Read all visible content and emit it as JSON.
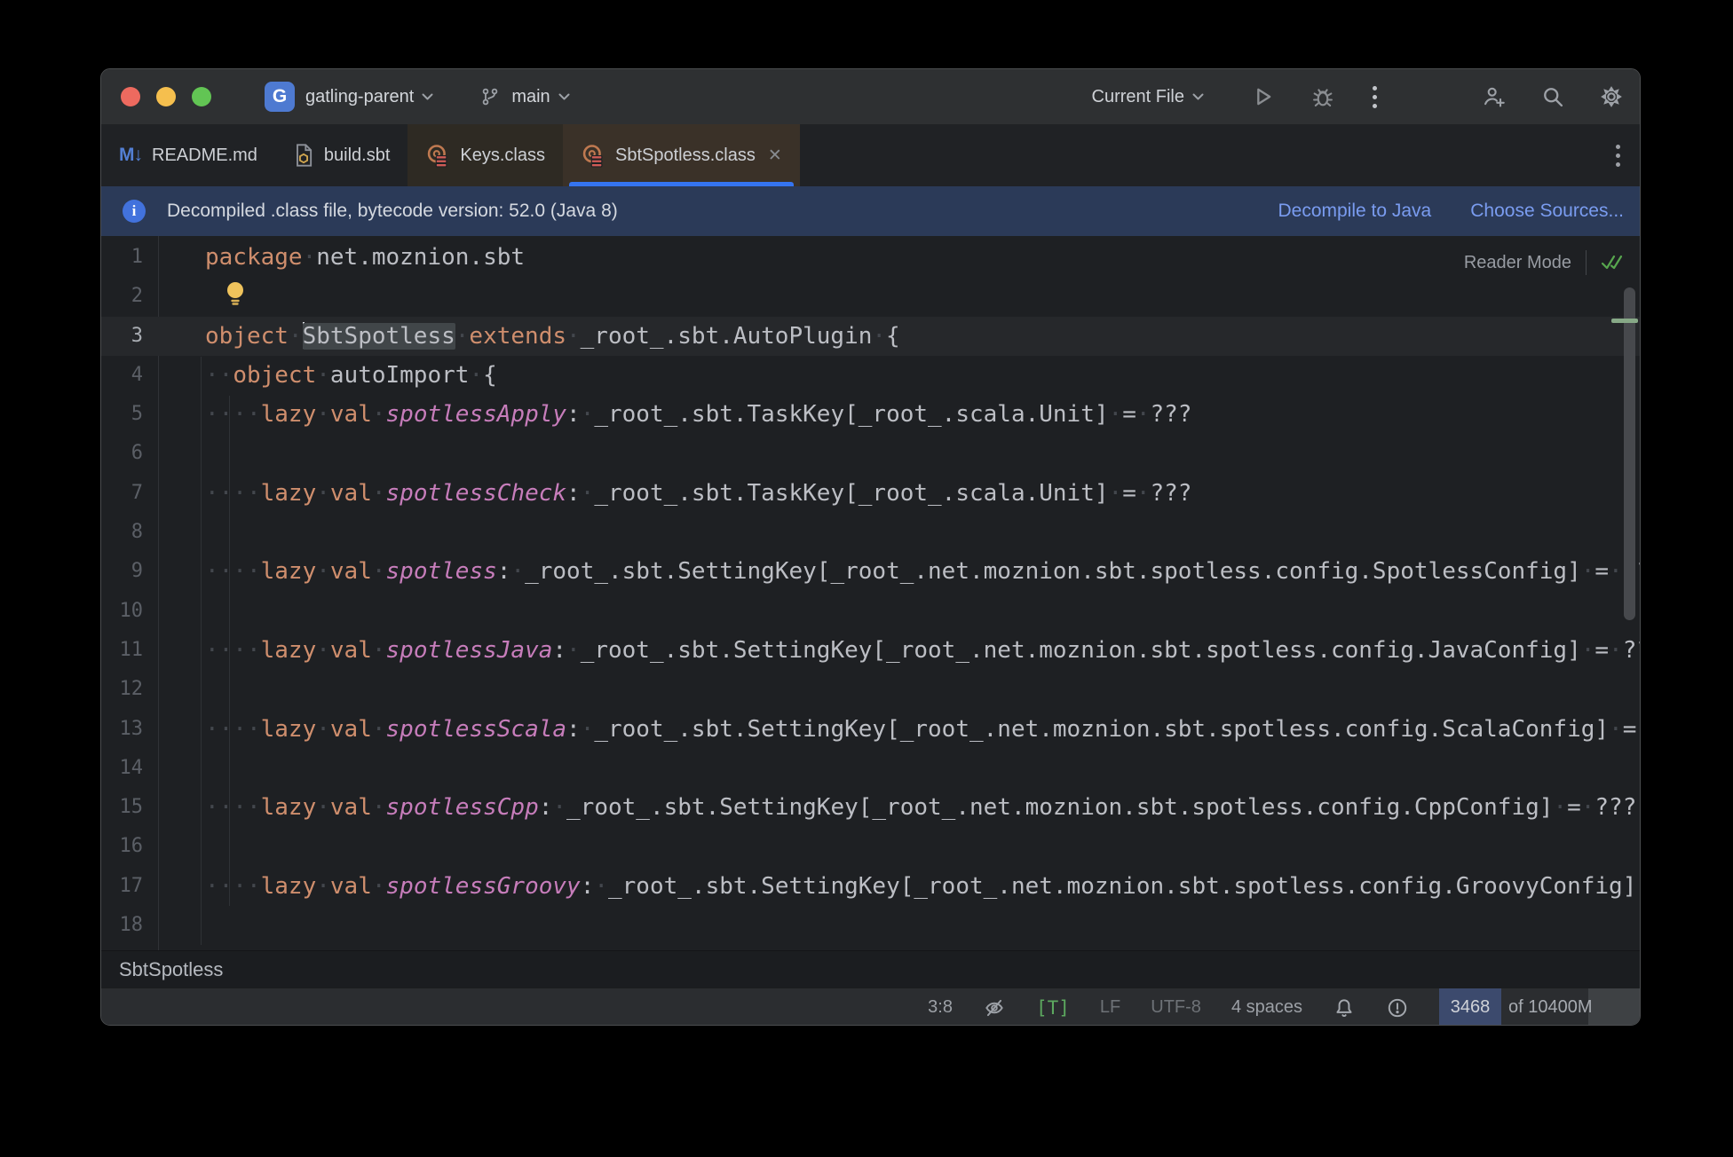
{
  "titlebar": {
    "project_initial": "G",
    "project": "gatling-parent",
    "branch": "main",
    "run_config": "Current File"
  },
  "tabs": [
    {
      "label": "README.md",
      "icon": "markdown-icon",
      "style": "plain",
      "closable": false
    },
    {
      "label": "build.sbt",
      "icon": "sbt-file-icon",
      "style": "plain",
      "closable": false
    },
    {
      "label": "Keys.class",
      "icon": "java-class-icon",
      "style": "warm",
      "closable": false
    },
    {
      "label": "SbtSpotless.class",
      "icon": "java-class-icon",
      "style": "active",
      "closable": true,
      "close_glyph": "✕"
    }
  ],
  "banner": {
    "message": "Decompiled .class file, bytecode version: 52.0 (Java 8)",
    "actions": [
      "Decompile to Java",
      "Choose Sources..."
    ]
  },
  "editor": {
    "reader_mode_label": "Reader Mode",
    "lines": [
      {
        "n": "1",
        "segs": [
          [
            "k",
            "package"
          ],
          [
            "w",
            "·"
          ],
          [
            "p",
            "net.moznion.sbt"
          ]
        ]
      },
      {
        "n": "2",
        "bulb": true,
        "segs": []
      },
      {
        "n": "3",
        "current": true,
        "caret_before_hl": true,
        "segs": [
          [
            "k",
            "object"
          ],
          [
            "w",
            "·"
          ],
          [
            "hl",
            "SbtSpotless"
          ],
          [
            "w",
            "·"
          ],
          [
            "k",
            "extends"
          ],
          [
            "w",
            "·"
          ],
          [
            "p",
            "_root_.sbt.AutoPlugin"
          ],
          [
            "w",
            "·"
          ],
          [
            "p",
            "{"
          ]
        ]
      },
      {
        "n": "4",
        "segs": [
          [
            "w",
            "··"
          ],
          [
            "k",
            "object"
          ],
          [
            "w",
            "·"
          ],
          [
            "p",
            "autoImport"
          ],
          [
            "w",
            "·"
          ],
          [
            "p",
            "{"
          ]
        ]
      },
      {
        "n": "5",
        "segs": [
          [
            "w",
            "····"
          ],
          [
            "k",
            "lazy"
          ],
          [
            "w",
            "·"
          ],
          [
            "k",
            "val"
          ],
          [
            "w",
            "·"
          ],
          [
            "i",
            "spotlessApply"
          ],
          [
            "p",
            ":"
          ],
          [
            "w",
            "·"
          ],
          [
            "p",
            "_root_.sbt.TaskKey[_root_.scala.Unit]"
          ],
          [
            "w",
            "·"
          ],
          [
            "p",
            "="
          ],
          [
            "w",
            "·"
          ],
          [
            "p",
            "???"
          ]
        ]
      },
      {
        "n": "6",
        "segs": []
      },
      {
        "n": "7",
        "segs": [
          [
            "w",
            "····"
          ],
          [
            "k",
            "lazy"
          ],
          [
            "w",
            "·"
          ],
          [
            "k",
            "val"
          ],
          [
            "w",
            "·"
          ],
          [
            "i",
            "spotlessCheck"
          ],
          [
            "p",
            ":"
          ],
          [
            "w",
            "·"
          ],
          [
            "p",
            "_root_.sbt.TaskKey[_root_.scala.Unit]"
          ],
          [
            "w",
            "·"
          ],
          [
            "p",
            "="
          ],
          [
            "w",
            "·"
          ],
          [
            "p",
            "???"
          ]
        ]
      },
      {
        "n": "8",
        "segs": []
      },
      {
        "n": "9",
        "segs": [
          [
            "w",
            "····"
          ],
          [
            "k",
            "lazy"
          ],
          [
            "w",
            "·"
          ],
          [
            "k",
            "val"
          ],
          [
            "w",
            "·"
          ],
          [
            "i",
            "spotless"
          ],
          [
            "p",
            ":"
          ],
          [
            "w",
            "·"
          ],
          [
            "p",
            "_root_.sbt.SettingKey[_root_.net.moznion.sbt.spotless.config.SpotlessConfig]"
          ],
          [
            "w",
            "·"
          ],
          [
            "p",
            "="
          ],
          [
            "w",
            "·"
          ],
          [
            "p",
            "???"
          ]
        ]
      },
      {
        "n": "10",
        "segs": []
      },
      {
        "n": "11",
        "segs": [
          [
            "w",
            "····"
          ],
          [
            "k",
            "lazy"
          ],
          [
            "w",
            "·"
          ],
          [
            "k",
            "val"
          ],
          [
            "w",
            "·"
          ],
          [
            "i",
            "spotlessJava"
          ],
          [
            "p",
            ":"
          ],
          [
            "w",
            "·"
          ],
          [
            "p",
            "_root_.sbt.SettingKey[_root_.net.moznion.sbt.spotless.config.JavaConfig]"
          ],
          [
            "w",
            "·"
          ],
          [
            "p",
            "="
          ],
          [
            "w",
            "·"
          ],
          [
            "p",
            "???"
          ]
        ]
      },
      {
        "n": "12",
        "segs": []
      },
      {
        "n": "13",
        "segs": [
          [
            "w",
            "····"
          ],
          [
            "k",
            "lazy"
          ],
          [
            "w",
            "·"
          ],
          [
            "k",
            "val"
          ],
          [
            "w",
            "·"
          ],
          [
            "i",
            "spotlessScala"
          ],
          [
            "p",
            ":"
          ],
          [
            "w",
            "·"
          ],
          [
            "p",
            "_root_.sbt.SettingKey[_root_.net.moznion.sbt.spotless.config.ScalaConfig]"
          ],
          [
            "w",
            "·"
          ],
          [
            "p",
            "="
          ],
          [
            "w",
            "·"
          ],
          [
            "p",
            "???"
          ]
        ]
      },
      {
        "n": "14",
        "segs": []
      },
      {
        "n": "15",
        "segs": [
          [
            "w",
            "····"
          ],
          [
            "k",
            "lazy"
          ],
          [
            "w",
            "·"
          ],
          [
            "k",
            "val"
          ],
          [
            "w",
            "·"
          ],
          [
            "i",
            "spotlessCpp"
          ],
          [
            "p",
            ":"
          ],
          [
            "w",
            "·"
          ],
          [
            "p",
            "_root_.sbt.SettingKey[_root_.net.moznion.sbt.spotless.config.CppConfig]"
          ],
          [
            "w",
            "·"
          ],
          [
            "p",
            "="
          ],
          [
            "w",
            "·"
          ],
          [
            "p",
            "???"
          ]
        ]
      },
      {
        "n": "16",
        "segs": []
      },
      {
        "n": "17",
        "segs": [
          [
            "w",
            "····"
          ],
          [
            "k",
            "lazy"
          ],
          [
            "w",
            "·"
          ],
          [
            "k",
            "val"
          ],
          [
            "w",
            "·"
          ],
          [
            "i",
            "spotlessGroovy"
          ],
          [
            "p",
            ":"
          ],
          [
            "w",
            "·"
          ],
          [
            "p",
            "_root_.sbt.SettingKey[_root_.net.moznion.sbt.spotless.config.GroovyConfig]"
          ],
          [
            "w",
            "·"
          ],
          [
            "p",
            "="
          ],
          [
            "w",
            "·"
          ],
          [
            "p",
            "???"
          ]
        ]
      },
      {
        "n": "18",
        "segs": []
      }
    ]
  },
  "breadcrumb": {
    "items": [
      "SbtSpotless"
    ]
  },
  "statusbar": {
    "position": "3:8",
    "t_badge": "[T]",
    "line_ending": "LF",
    "encoding": "UTF-8",
    "indent": "4 spaces",
    "memory_used": "3468",
    "memory_total": "of 10400M"
  }
}
